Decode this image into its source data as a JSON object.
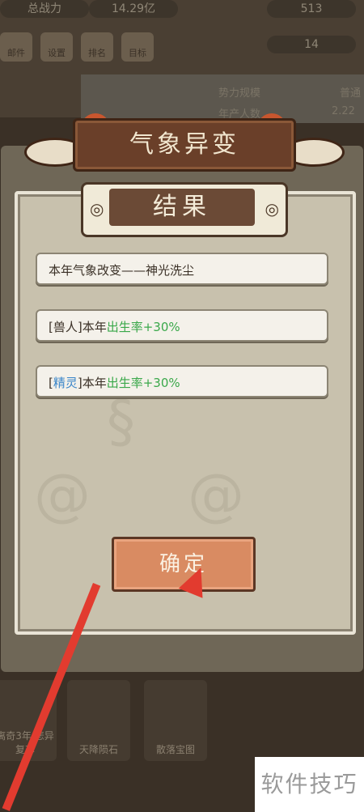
{
  "background": {
    "top_title": "总战力",
    "power_value": "14.29亿",
    "resource_a": "513",
    "resource_b": "14",
    "buttons": [
      "邮件",
      "设置",
      "排名",
      "目标"
    ],
    "panel_label_1": "势力规模",
    "panel_label_2": "年产人数",
    "panel_value_1": "普通",
    "panel_value_2": "2.22",
    "bottom_items": [
      "离奇3年\n悲异复苏",
      "天降陨石",
      "散落宝图"
    ]
  },
  "popup": {
    "title": "气象异变",
    "subtitle": "结果",
    "results": [
      {
        "prefix": "",
        "tag": "",
        "text": "本年气象改变——神光洗尘",
        "highlight": ""
      },
      {
        "prefix": "[",
        "tag": "兽人",
        "text": "]本年",
        "highlight": "出生率+30%"
      },
      {
        "prefix": "[",
        "tag": "精灵",
        "text": "]本年",
        "highlight": "出生率+30%"
      }
    ],
    "confirm_label": "确定"
  },
  "watermark": "软件技巧",
  "colors": {
    "highlight_green": "#3aa84a",
    "tag_blue": "#3b86c9",
    "arrow_red": "#e23b2f"
  }
}
